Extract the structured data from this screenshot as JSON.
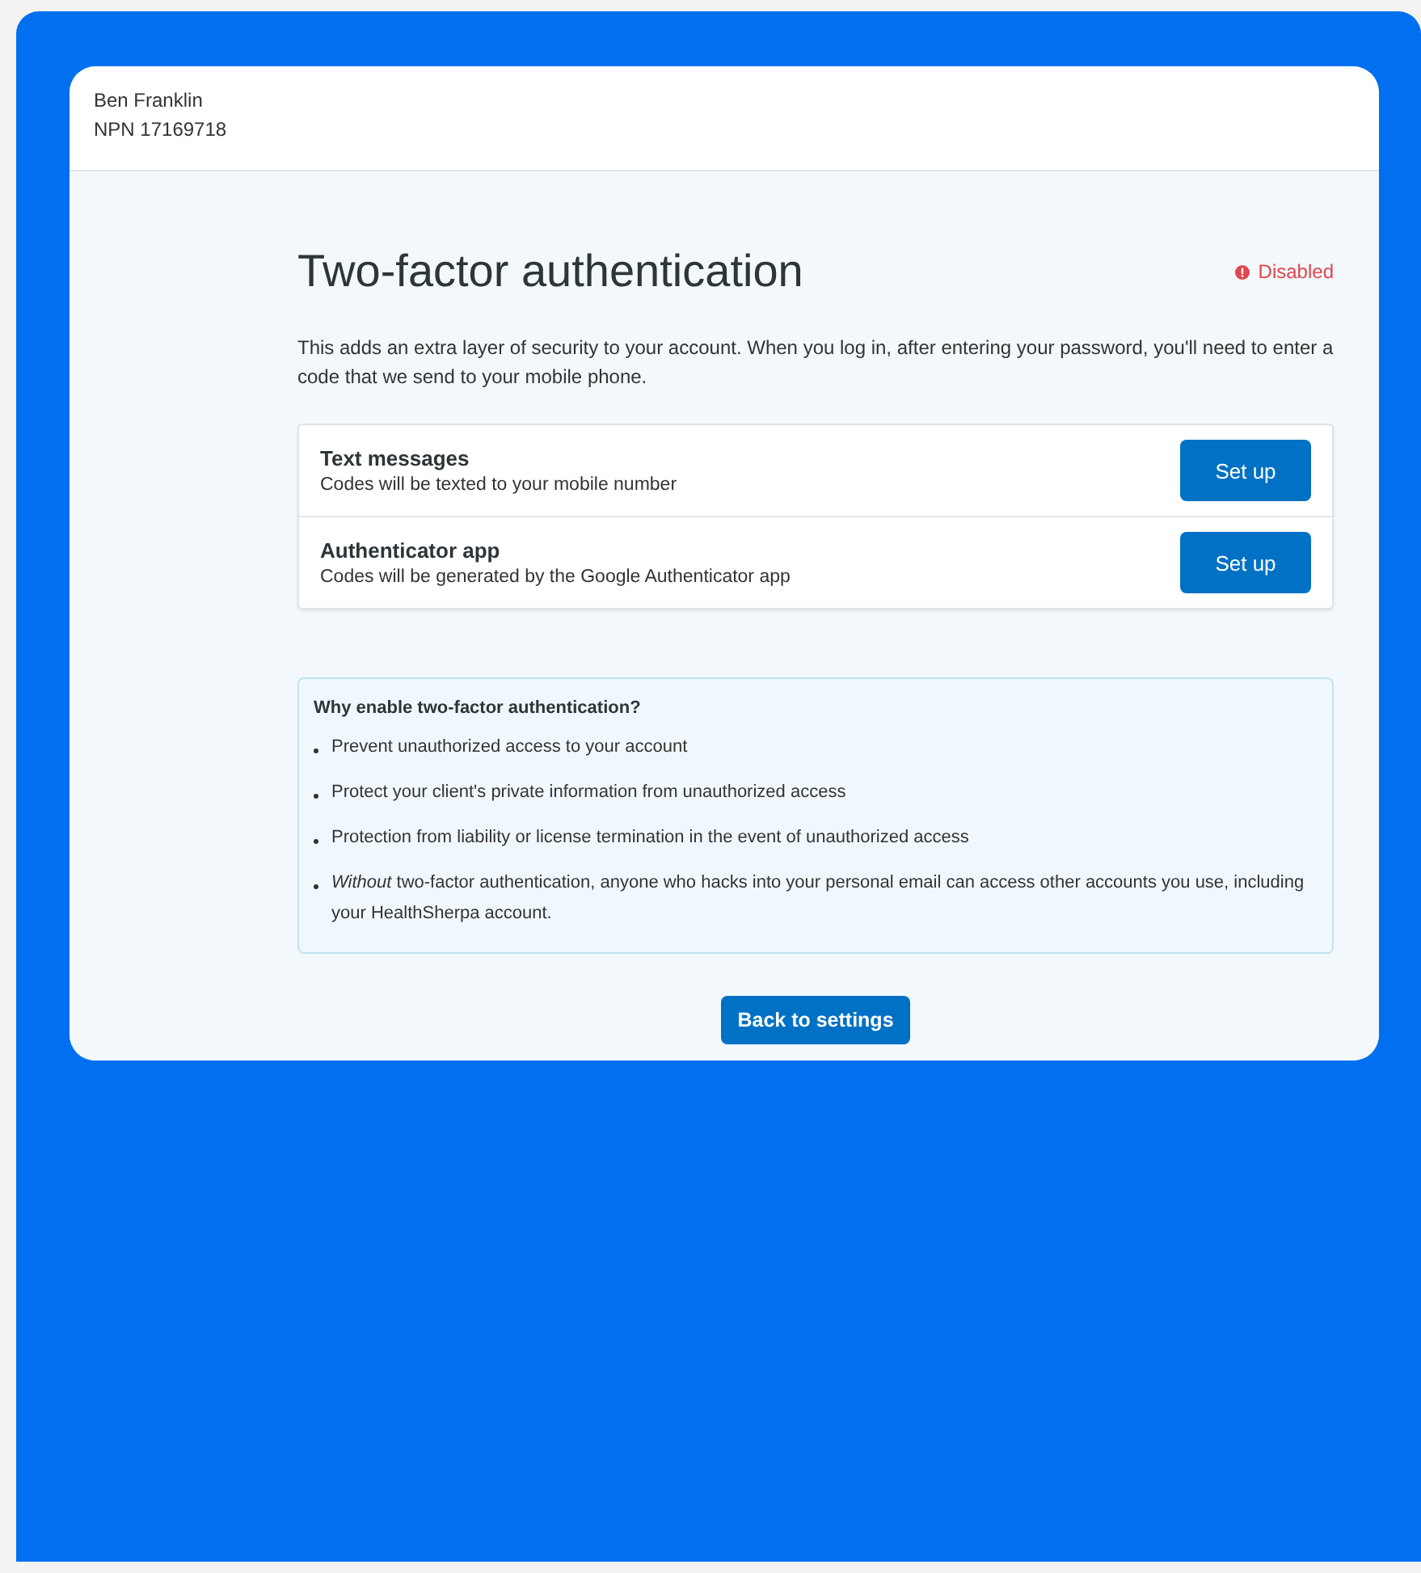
{
  "user": {
    "name": "Ben Franklin",
    "npn": "NPN 17169718"
  },
  "title": "Two-factor authentication",
  "status": {
    "label": "Disabled"
  },
  "intro": "This adds an extra layer of security to your account. When you log in, after entering your password, you'll need to enter a code that we send to your mobile phone.",
  "methods": [
    {
      "title": "Text messages",
      "description": "Codes will be texted to your mobile number",
      "button": "Set up"
    },
    {
      "title": "Authenticator app",
      "description": "Codes will be generated by the Google Authenticator app",
      "button": "Set up"
    }
  ],
  "why": {
    "heading": "Why enable two-factor authentication?",
    "items": [
      "Prevent unauthorized access to your account",
      "Protect your client's private information from unauthorized access",
      "Protection from liability or license termination in the event of unauthorized access",
      "*Without* two-factor authentication, anyone who hacks into your personal email can access other accounts you use, including your HealthSherpa account."
    ]
  },
  "back_button": "Back to settings"
}
